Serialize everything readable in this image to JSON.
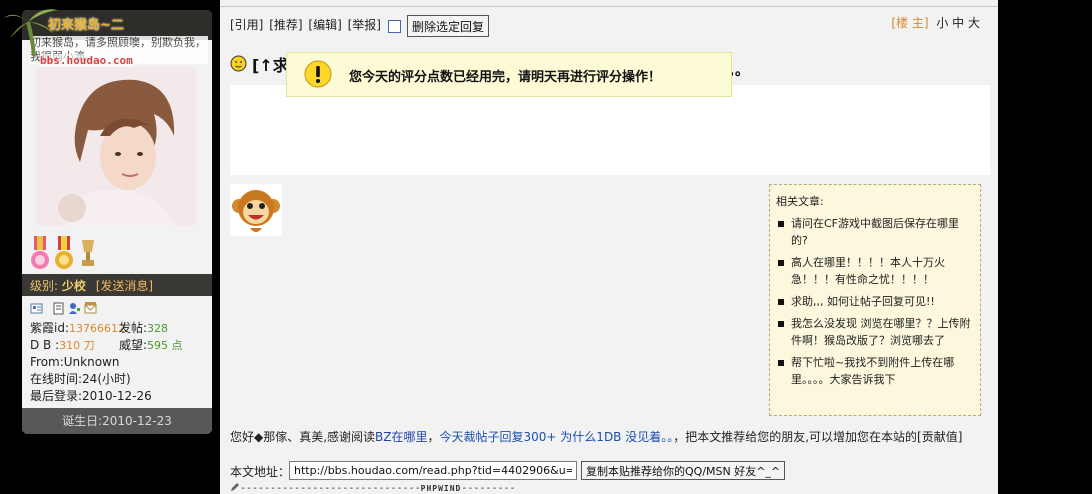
{
  "user": {
    "logo_url": "bbs.houdao.com",
    "username": "初来猴岛~二",
    "signature": "初来猴岛，请多照顾噢，别欺负我，我很弱小滴。",
    "level_label": "级别:",
    "level_name": "少校",
    "send_message": "[发送消息]",
    "stats": {
      "ziwei_label": "紫霞id:",
      "ziwei_value": "13766612",
      "posts_label": "发帖:",
      "posts_value": "328",
      "db_label": "D B :",
      "db_value": "310 刀",
      "prestige_label": "威望:",
      "prestige_value": "595 点",
      "from": "From:Unknown",
      "online": "在线时间:24(小时)",
      "last_login": "最后登录:2010-12-26"
    },
    "birthday": "诞生日:2010-12-23"
  },
  "post": {
    "actions": [
      "[引用]",
      "[推荐]",
      "[编辑]",
      "[举报]"
    ],
    "delete_selected": "删除选定回复",
    "floor_label": "[楼 主]",
    "font_sizes": "小 中 大",
    "title_prefix": "[↑求",
    "title_tail": "。。",
    "alert_icon": "exclamation-icon",
    "alert_text": "您今天的评分点数已经用完，请明天再进行评分操作！"
  },
  "related": {
    "title": "相关文章:",
    "items": [
      "请问在CF游戏中截图后保存在哪里的?",
      "高人在哪里！！！！本人十万火急！！！有性命之忧！！！！",
      "求助,,, 如何让帖子回复可见!!",
      "我怎么没发现 浏览在哪里？？上传附件啊！猴岛改版了？浏览哪去了",
      "帮下忙啦~我找不到附件上传在哪里。。。。大家告诉我下"
    ]
  },
  "footer": {
    "greeting": "您好◆那傢、真美,感谢阅读",
    "keyword1": "BZ在哪里",
    "comma": "，",
    "keyword2": "今天裁帖子回复300+ 为什么1DB 没见着。。",
    "rest": "，把本文推荐给您的朋友,可以增加您在本站的[贡献值]",
    "url_label": "本文地址：",
    "url_value": "http://bbs.houdao.com/read.php?tid=4402906&u=9",
    "copy_button": "复制本贴推荐给你的QQ/MSN 好友^_^",
    "sign_dashes": "------------------------------",
    "sign_brand": "PHPWIND",
    "sign_dashes2": "---------"
  },
  "colors": {
    "level_bar": "#3a3834",
    "level_text": "#f0d06e",
    "stat_orange": "#d9892a",
    "stat_green": "#4a9a2a",
    "related_bg": "#fcf7dd",
    "alert_bg": "#fdfbd6",
    "link_blue": "#2244aa"
  }
}
